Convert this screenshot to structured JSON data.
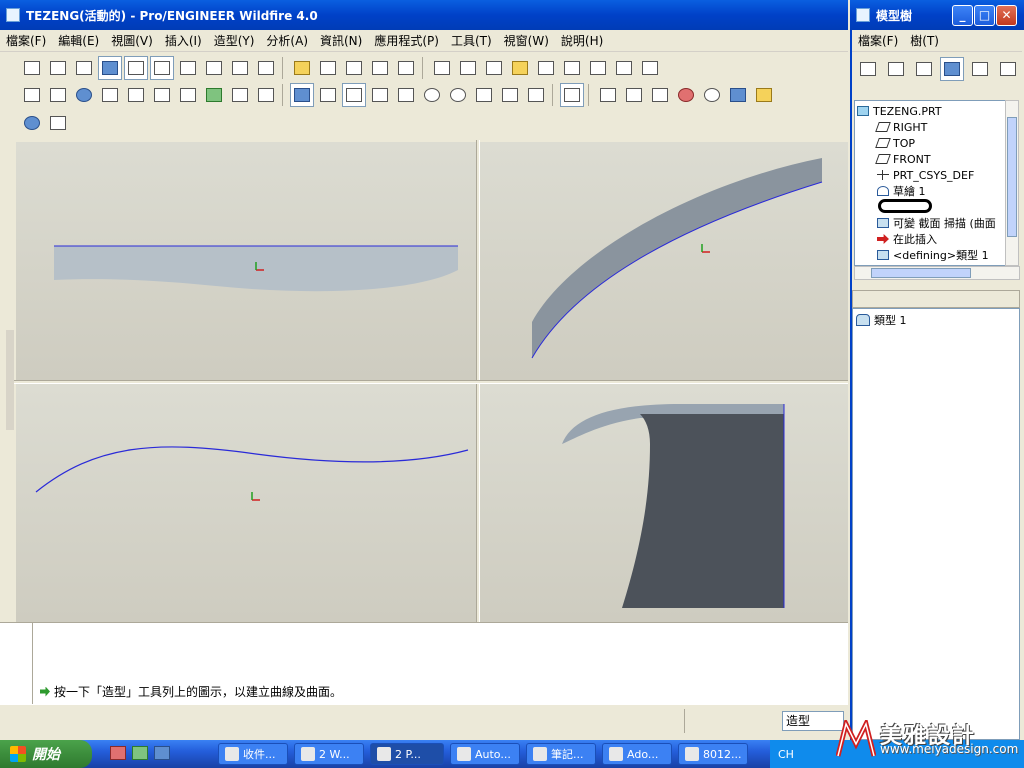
{
  "main_window": {
    "title": "TEZENG(活動的) - Pro/ENGINEER Wildfire 4.0",
    "menu": [
      "檔案(F)",
      "編輯(E)",
      "視圖(V)",
      "插入(I)",
      "造型(Y)",
      "分析(A)",
      "資訊(N)",
      "應用程式(P)",
      "工具(T)",
      "視窗(W)",
      "說明(H)"
    ]
  },
  "model_tree_window": {
    "title": "模型樹",
    "menu": [
      "檔案(F)",
      "樹(T)"
    ],
    "items": [
      {
        "label": "TEZENG.PRT",
        "icon": "part-icon"
      },
      {
        "label": "RIGHT",
        "icon": "datum-plane-icon"
      },
      {
        "label": "TOP",
        "icon": "datum-plane-icon"
      },
      {
        "label": "FRONT",
        "icon": "datum-plane-icon"
      },
      {
        "label": "PRT_CSYS_DEF",
        "icon": "csys-icon"
      },
      {
        "label": "草繪 1",
        "icon": "sketch-icon"
      },
      {
        "label": "",
        "icon": "redacted"
      },
      {
        "label": "可變 截面 掃描 (曲面",
        "icon": "sweep-icon"
      },
      {
        "label": "在此插入",
        "icon": "insert-here-icon"
      },
      {
        "label": "<defining>類型 1",
        "icon": "style-feature-icon"
      }
    ],
    "lower_item": "類型 1"
  },
  "message": "按一下「造型」工具列上的圖示，以建立曲線及曲面。",
  "status_select": "造型",
  "taskbar": {
    "start": "開始",
    "tasks": [
      "收件...",
      "2 W...",
      "2 P...",
      "Auto...",
      "筆記...",
      "Ado...",
      "8012..."
    ],
    "active_task": 2,
    "tray_lang": "CH"
  },
  "watermark": {
    "text": "美雅設計",
    "url": "www.meiyadesign.com"
  },
  "colors": {
    "titlebar": "#0041c8",
    "curve": "#2a2ad8",
    "surface": "#9aa6b0",
    "surface_dark": "#4c525a"
  }
}
